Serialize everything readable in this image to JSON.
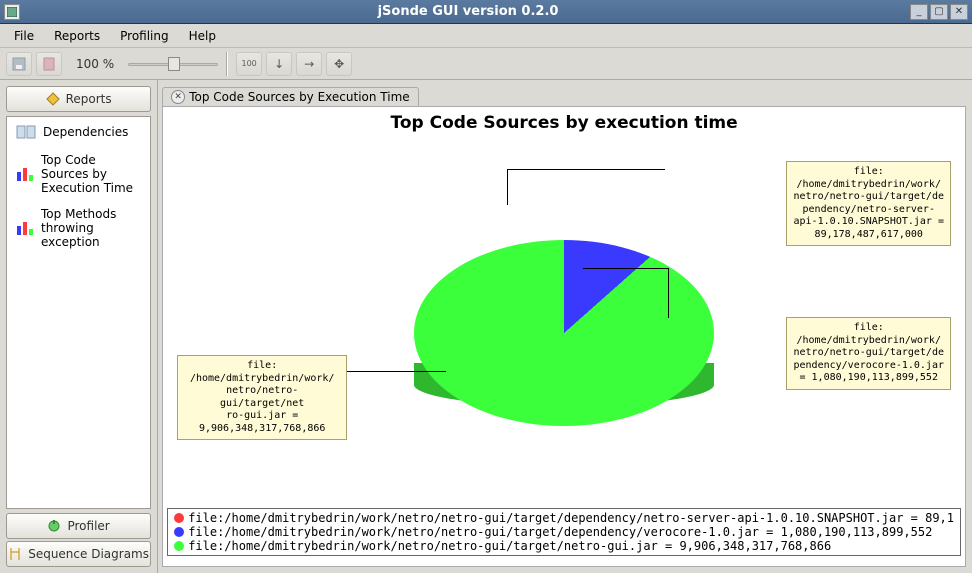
{
  "window": {
    "title": "jSonde GUI version 0.2.0"
  },
  "menu": {
    "file": "File",
    "reports": "Reports",
    "profiling": "Profiling",
    "help": "Help"
  },
  "toolbar": {
    "zoom": "100 %"
  },
  "sidebar": {
    "reports_btn": "Reports",
    "profiler_btn": "Profiler",
    "seqdiag_btn": "Sequence Diagrams",
    "items": [
      {
        "label": "Dependencies"
      },
      {
        "label": "Top Code Sources by Execution Time"
      },
      {
        "label": "Top Methods throwing exception"
      }
    ]
  },
  "tab": {
    "title": "Top Code Sources by Execution Time"
  },
  "chart": {
    "title": "Top Code Sources by execution time"
  },
  "chart_data": {
    "type": "pie",
    "title": "Top Code Sources by execution time",
    "series": [
      {
        "name": "file:/home/dmitrybedrin/work/netro/netro-gui/target/dependency/netro-server-api-1.0.10.SNAPSHOT.jar",
        "value": 89178487617000,
        "color": "#ff3a3a"
      },
      {
        "name": "file:/home/dmitrybedrin/work/netro/netro-gui/target/dependency/verocore-1.0.jar",
        "value": 1080190113899552,
        "color": "#3a3aff"
      },
      {
        "name": "file:/home/dmitrybedrin/work/netro/netro-gui/target/netro-gui.jar",
        "value": 9906348317768866,
        "color": "#3aff3a"
      }
    ]
  },
  "callouts": {
    "c0": "file:\n/home/dmitrybedrin/work/\nnetro/netro-gui/target/de\npendency/netro-server-\napi-1.0.10.SNAPSHOT.jar =\n89,178,487,617,000",
    "c1": "file:\n/home/dmitrybedrin/work/\nnetro/netro-gui/target/de\npendency/verocore-1.0.jar\n= 1,080,190,113,899,552",
    "c2": "file:\n/home/dmitrybedrin/work/\nnetro/netro-gui/target/net\nro-gui.jar =\n9,906,348,317,768,866"
  },
  "legend": {
    "l0": "file:/home/dmitrybedrin/work/netro/netro-gui/target/dependency/netro-server-api-1.0.10.SNAPSHOT.jar = 89,1",
    "l1": "file:/home/dmitrybedrin/work/netro/netro-gui/target/dependency/verocore-1.0.jar = 1,080,190,113,899,552",
    "l2": "file:/home/dmitrybedrin/work/netro/netro-gui/target/netro-gui.jar = 9,906,348,317,768,866"
  }
}
